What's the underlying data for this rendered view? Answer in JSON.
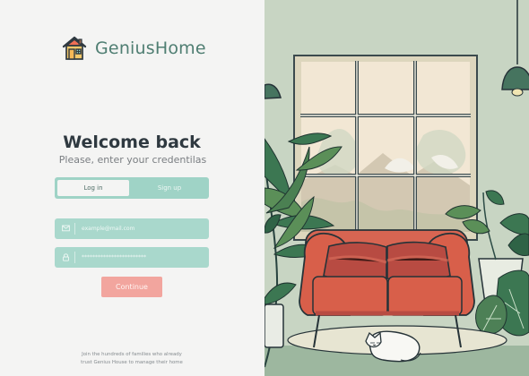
{
  "brand": {
    "name": "GeniusHome",
    "icon": "house-icon"
  },
  "login": {
    "heading": "Welcome back",
    "subtitle": "Please, enter your credentilas",
    "tabs": [
      {
        "label": "Log in"
      },
      {
        "label": "Sign up"
      }
    ],
    "email": {
      "placeholder": "example@mail.com",
      "icon": "mail-icon"
    },
    "password": {
      "placeholder": "************************",
      "icon": "lock-icon"
    },
    "continue_label": "Continue",
    "footer": [
      "Join the hundreds of families who already",
      "trust Genius House to manage their home"
    ]
  },
  "colors": {
    "brand_green": "#4f7e72",
    "mint": "#9fd3c6",
    "coral_button": "#f2a59e",
    "illustration_wall": "#c7d5c4",
    "sofa": "#d85f4a"
  }
}
